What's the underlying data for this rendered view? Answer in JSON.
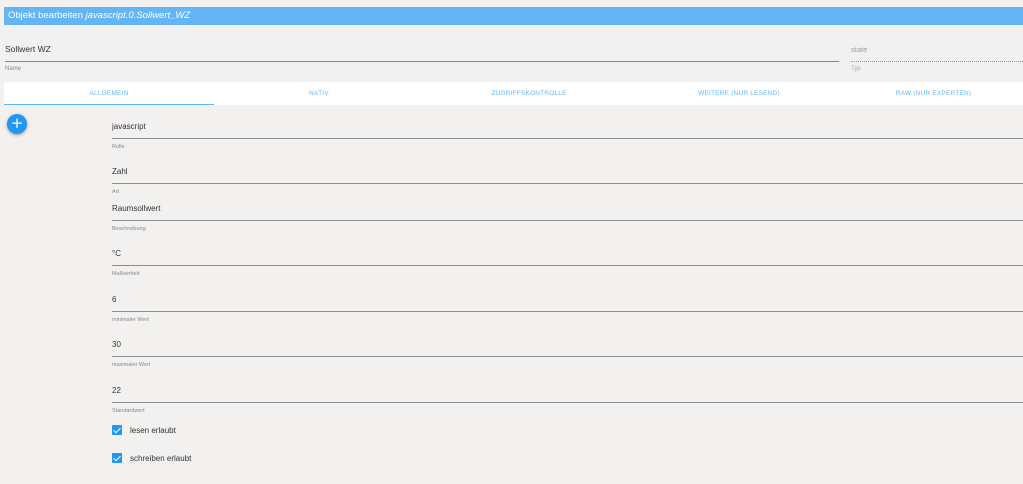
{
  "dialog": {
    "title_prefix": "Objekt bearbeiten ",
    "title_object": "javascript.0.Sollwert_WZ"
  },
  "header": {
    "name_value": "Sollwert WZ",
    "name_label": "Name",
    "type_value": "state",
    "type_label": "Typ"
  },
  "tabs": [
    {
      "label": "Allgemein"
    },
    {
      "label": "Nativ"
    },
    {
      "label": "Zugriffskontrolle"
    },
    {
      "label": "Weitere (nur lesend)"
    },
    {
      "label": "Raw (nur Experten)"
    }
  ],
  "add_button": {
    "label": "+"
  },
  "fields": [
    {
      "value": "javascript",
      "label": "Rolle"
    },
    {
      "value": "Zahl",
      "label": "Art"
    },
    {
      "value": "Raumsollwert",
      "label": "Beschreibung"
    },
    {
      "value": "°C",
      "label": "Maßeinheit"
    },
    {
      "value": "6",
      "label": "minimaler Wert"
    },
    {
      "value": "30",
      "label": "maximaler Wert"
    },
    {
      "value": "22",
      "label": "Standardwert"
    }
  ],
  "checkboxes": [
    {
      "label": "lesen erlaubt",
      "checked": true
    },
    {
      "label": "schreiben erlaubt",
      "checked": true
    }
  ],
  "colors": {
    "accent": "#2196f3",
    "title_bar": "#64b5f6",
    "background": "#f3f1ef"
  }
}
